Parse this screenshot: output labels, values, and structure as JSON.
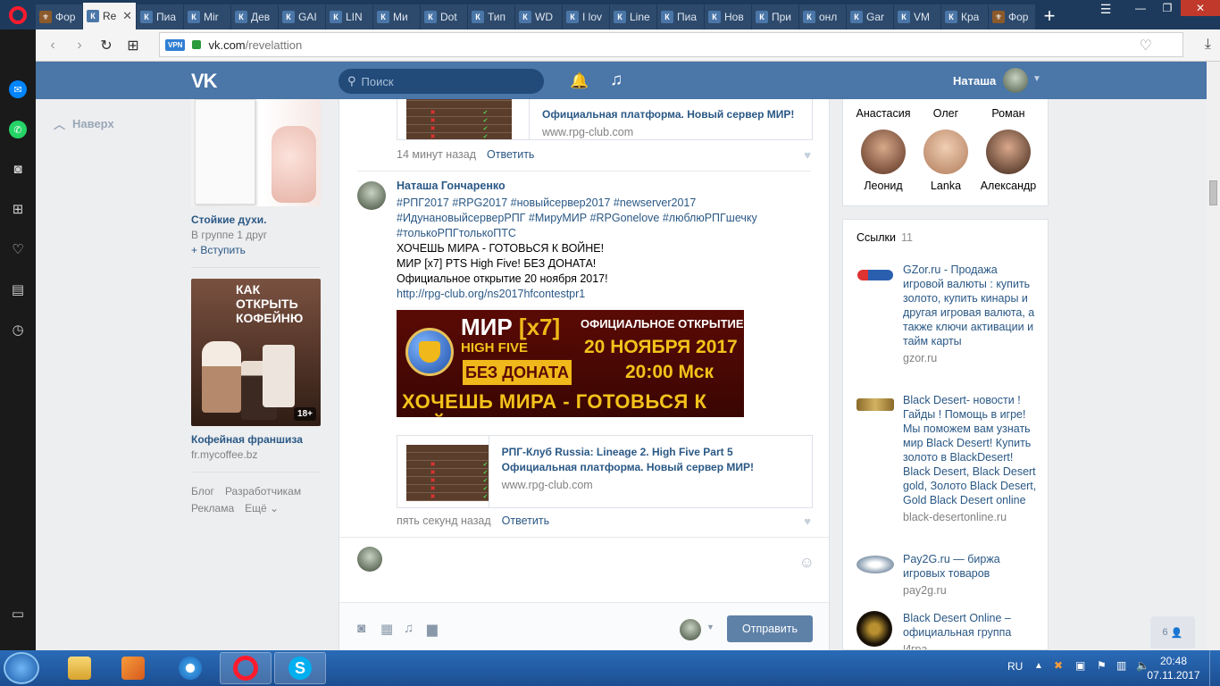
{
  "browser": {
    "tabs": [
      {
        "fav": "fo",
        "icon_text": "⚜",
        "label": "Фор"
      },
      {
        "fav": "vk",
        "icon_text": "К",
        "label": "Re",
        "active": true
      },
      {
        "fav": "vk",
        "icon_text": "К",
        "label": "Пиа"
      },
      {
        "fav": "vk",
        "icon_text": "К",
        "label": "Mir"
      },
      {
        "fav": "vk",
        "icon_text": "К",
        "label": "Дев"
      },
      {
        "fav": "vk",
        "icon_text": "К",
        "label": "GAI"
      },
      {
        "fav": "vk",
        "icon_text": "К",
        "label": "LIN"
      },
      {
        "fav": "vk",
        "icon_text": "К",
        "label": "Ми"
      },
      {
        "fav": "vk",
        "icon_text": "К",
        "label": "Dot"
      },
      {
        "fav": "vk",
        "icon_text": "К",
        "label": "Тип"
      },
      {
        "fav": "vk",
        "icon_text": "К",
        "label": "WD"
      },
      {
        "fav": "vk",
        "icon_text": "К",
        "label": "I lov"
      },
      {
        "fav": "vk",
        "icon_text": "К",
        "label": "Line"
      },
      {
        "fav": "vk",
        "icon_text": "К",
        "label": "Пиа"
      },
      {
        "fav": "vk",
        "icon_text": "К",
        "label": "Нов"
      },
      {
        "fav": "vk",
        "icon_text": "К",
        "label": "При"
      },
      {
        "fav": "vk",
        "icon_text": "К",
        "label": "онл"
      },
      {
        "fav": "vk",
        "icon_text": "К",
        "label": "Gar"
      },
      {
        "fav": "vk",
        "icon_text": "К",
        "label": "VM"
      },
      {
        "fav": "vk",
        "icon_text": "К",
        "label": "Кра"
      },
      {
        "fav": "fo",
        "icon_text": "⚜",
        "label": "Фор"
      }
    ],
    "vpn_badge": "VPN",
    "url_host": "vk.com",
    "url_path": "/revelattion"
  },
  "vk": {
    "search_placeholder": "Поиск",
    "user_name": "Наташа",
    "back_to_top": "Наверх"
  },
  "ads": [
    {
      "title": "Стойкие духи.",
      "sub": "В группе 1 друг",
      "action": "+ Вступить",
      "img": "perfume"
    },
    {
      "title": "Кофейная франшиза",
      "sub": "fr.mycoffee.bz",
      "img": "coffee",
      "img_text": "КАК ОТКРЫТЬ КОФЕЙНЮ",
      "badge": "18+"
    }
  ],
  "footer_links": [
    "Блог",
    "Разработчикам",
    "Реклама",
    "Ещё ⌄"
  ],
  "feed": {
    "comment1": {
      "card_title": "Официальная платформа. Новый сервер МИР!",
      "card_domain": "www.rpg-club.com",
      "time": "14 минут назад",
      "reply": "Ответить"
    },
    "comment2": {
      "author": "Наташа Гончаренко",
      "hashtags_1": "#РПГ2017 #RPG2017 #новыйсервер2017 #newserver2017",
      "hashtags_2": "#ИдунановыйсерверРПГ #МируМИР #RPGonelove #люблюРПГшечку",
      "hashtags_3": "#толькоРПГтолькоПТС",
      "line1": "ХОЧЕШЬ МИРА - ГОТОВЬСЯ К ВОЙНЕ!",
      "line2": "МИР [x7] PTS High Five! БЕЗ ДОНАТА!",
      "line3": "Официальное открытие 20 ноября 2017!",
      "link": "http://rpg-club.org/ns2017hfcontestpr1",
      "banner": {
        "mir": "МИР",
        "x7": "[x7]",
        "hf": "HIGH FIVE",
        "nodonat": "БЕЗ ДОНАТА",
        "opening": "ОФИЦИАЛЬНОЕ ОТКРЫТИЕ",
        "date": "20 НОЯБРЯ 2017",
        "time": "20:00 Мск",
        "slogan": "ХОЧЕШЬ МИРА - ГОТОВЬСЯ К ВОЙНЕ"
      },
      "card_title": "РПГ-Клуб Russia: Lineage 2. High Five Part 5 Официальная платформа. Новый сервер МИР!",
      "card_domain": "www.rpg-club.com",
      "time": "пять секунд назад",
      "reply": "Ответить"
    },
    "send_label": "Отправить"
  },
  "friends": [
    {
      "name": "Анастасия"
    },
    {
      "name": "Олег"
    },
    {
      "name": "Роман"
    },
    {
      "name": "Леонид",
      "color": "#6b3a2a"
    },
    {
      "name": "Lanka",
      "color": "#c9a688"
    },
    {
      "name": "Александр",
      "color": "#7a4a3a"
    }
  ],
  "links": {
    "header": "Ссылки",
    "count": "11",
    "items": [
      {
        "text": "GZor.ru - Продажа игровой валюты : купить золото, купить кинары и другая игровая валюта, а также ключи активации и тайм карты",
        "domain": "gzor.ru",
        "icon": "gzor"
      },
      {
        "text": "Black Desert- новости ! Гайды ! Помощь в игре! Мы поможем вам узнать мир Black Desert! Купить золото в BlackDesert! Black Desert, Black Desert gold, Золото Black Desert, Gold Black Desert online",
        "domain": "black-desertonline.ru",
        "icon": "bd"
      },
      {
        "text": "Pay2G.ru — биржа игровых товаров",
        "domain": "pay2g.ru",
        "icon": "pay2g"
      },
      {
        "text": "Black Desert Online – официальная группа",
        "domain": "Игра",
        "icon": "bdo"
      }
    ]
  },
  "chat_count": "6",
  "taskbar": {
    "lang": "RU",
    "time": "20:48",
    "date": "07.11.2017"
  },
  "colors": {
    "vk_blue": "#4a76a8",
    "link": "#2a5885",
    "opera_red": "#ff1b2d"
  }
}
